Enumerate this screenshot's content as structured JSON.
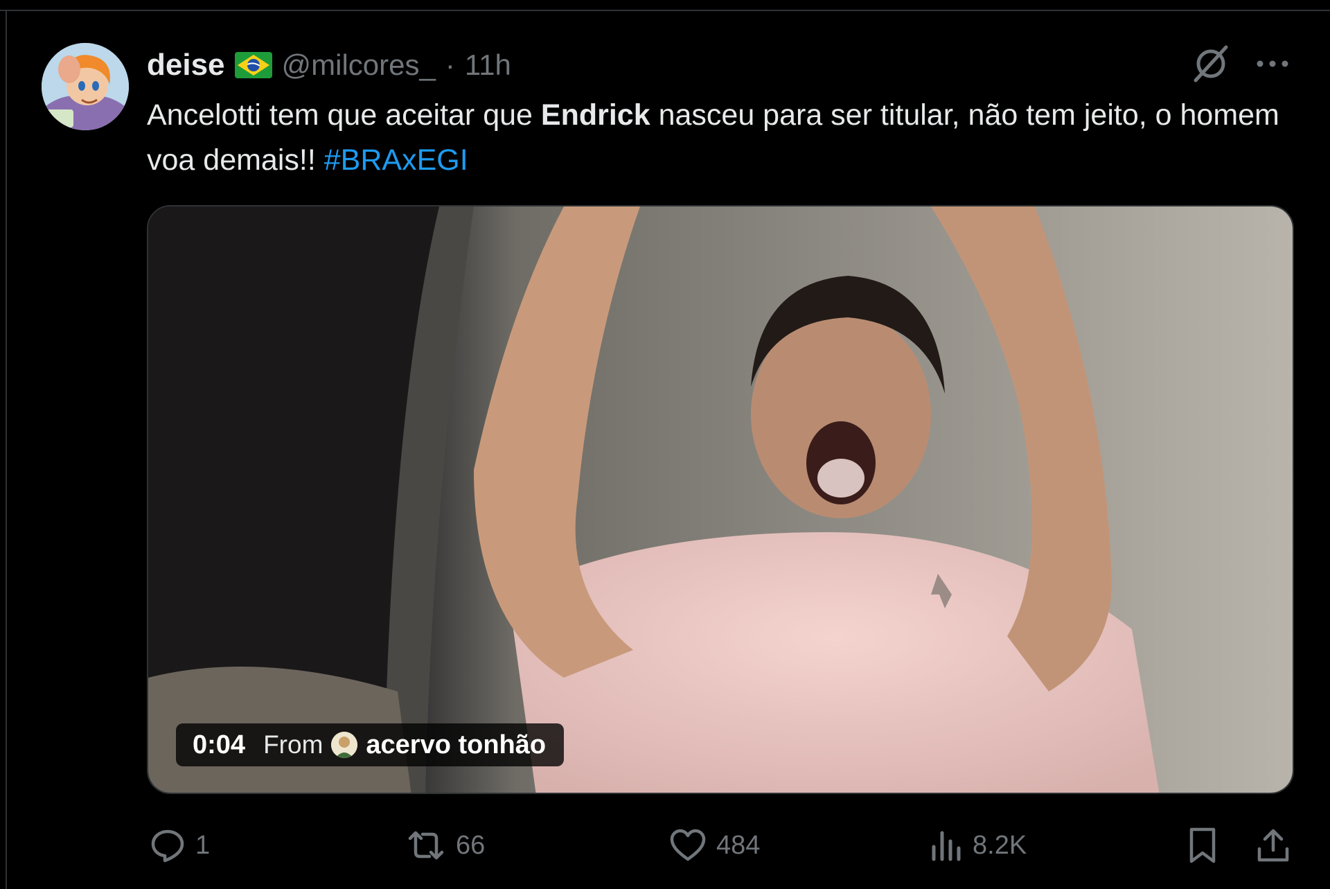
{
  "tweet": {
    "author_name": "deise",
    "author_handle": "@milcores_",
    "separator": "·",
    "time": "11h",
    "text_part1": "Ancelotti tem que aceitar que ",
    "text_bold": "Endrick",
    "text_part2": " nasceu para ser titular, não tem jeito, o homem voa demais!! ",
    "hashtag": "#BRAxEGI"
  },
  "media": {
    "duration": "0:04",
    "from_label": "From",
    "source_name": "acervo tonhão"
  },
  "actions": {
    "replies": "1",
    "reposts": "66",
    "likes": "484",
    "views": "8.2K"
  },
  "colors": {
    "background": "#000000",
    "text": "#e7e9ea",
    "secondary": "#71767b",
    "link": "#1d9bf0",
    "border": "#2f3336"
  }
}
